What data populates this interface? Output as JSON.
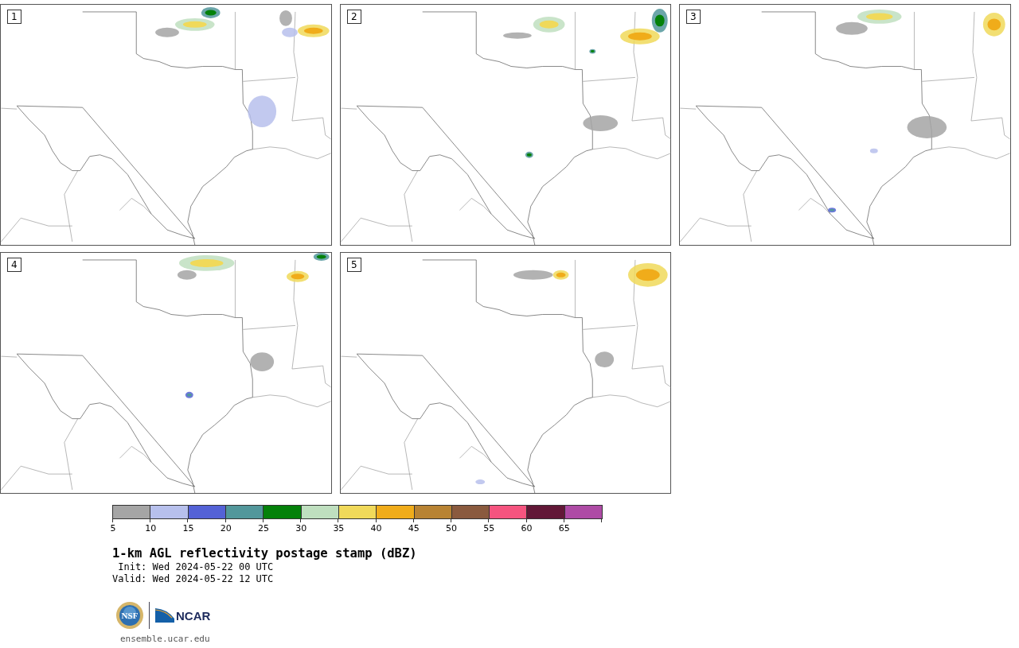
{
  "panels": [
    {
      "number": "1"
    },
    {
      "number": "2"
    },
    {
      "number": "3"
    },
    {
      "number": "4"
    },
    {
      "number": "5"
    }
  ],
  "colorbar": {
    "bins": [
      {
        "label": "5",
        "color": "#a5a5a5"
      },
      {
        "label": "10",
        "color": "#b7c0ec"
      },
      {
        "label": "15",
        "color": "#5462d6"
      },
      {
        "label": "20",
        "color": "#52979b"
      },
      {
        "label": "25",
        "color": "#04810a"
      },
      {
        "label": "30",
        "color": "#bfdfbf"
      },
      {
        "label": "35",
        "color": "#f0d95a"
      },
      {
        "label": "40",
        "color": "#f0ac1a"
      },
      {
        "label": "45",
        "color": "#b88333"
      },
      {
        "label": "50",
        "color": "#8a5a3e"
      },
      {
        "label": "55",
        "color": "#f5547f"
      },
      {
        "label": "60",
        "color": "#621837"
      },
      {
        "label": "65",
        "color": "#ae4ba5"
      }
    ]
  },
  "title": "1-km AGL reflectivity postage stamp (dBZ)",
  "times": [
    {
      "label": "Init:",
      "value": "Wed 2024-05-22 00 UTC"
    },
    {
      "label": "Valid:",
      "value": "Wed 2024-05-22 12 UTC"
    }
  ],
  "logos": {
    "seal": "NSF",
    "wordmark": "NCAR"
  },
  "site": "ensemble.ucar.edu"
}
